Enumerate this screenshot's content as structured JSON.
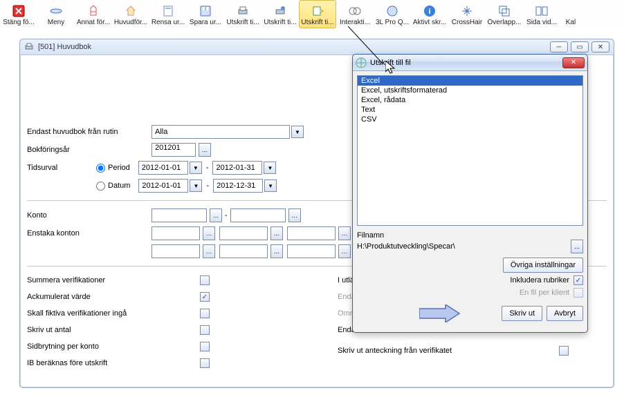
{
  "toolbar": {
    "items": [
      {
        "label": "Stäng fö..."
      },
      {
        "label": "Meny"
      },
      {
        "label": "Annat för..."
      },
      {
        "label": "Huvudför..."
      },
      {
        "label": "Rensa ur..."
      },
      {
        "label": "Spara ur..."
      },
      {
        "label": "Utskrift ti..."
      },
      {
        "label": "Utskrift ti..."
      },
      {
        "label": "Utskrift ti..."
      },
      {
        "label": "Interakti..."
      },
      {
        "label": "3L Pro Q..."
      },
      {
        "label": "Aktivt skr..."
      },
      {
        "label": "CrossHair"
      },
      {
        "label": "Överlapp..."
      },
      {
        "label": "Sida vid..."
      },
      {
        "label": "Kal"
      }
    ]
  },
  "window": {
    "title": "[501]  Huvudbok"
  },
  "form": {
    "rutin_label": "Endast huvudbok från rutin",
    "rutin_value": "Alla",
    "bokforingsar_label": "Bokföringsår",
    "bokforingsar_value": "201201",
    "tidsurval_label": "Tidsurval",
    "period_label": "Period",
    "datum_label": "Datum",
    "period_from": "2012-01-01",
    "period_to": "2012-01-31",
    "datum_from": "2012-01-01",
    "datum_to": "2012-12-31",
    "dash": "-",
    "konto_label": "Konto",
    "enstaka_label": "Enstaka konton",
    "opts_left": [
      {
        "label": "Summera verifikationer",
        "checked": false
      },
      {
        "label": "Ackumulerat värde",
        "checked": true
      },
      {
        "label": "Skall fiktiva verifikationer ingå",
        "checked": false
      },
      {
        "label": "Skriv ut antal",
        "checked": false
      },
      {
        "label": "Sidbrytning per konto",
        "checked": false
      },
      {
        "label": "IB beräknas före utskrift",
        "checked": false
      }
    ],
    "opts_right": [
      {
        "label": "I utländsk valuta",
        "muted": false
      },
      {
        "label": "Endast valuta",
        "muted": true
      },
      {
        "label": "Omräkningsdatum",
        "muted": true
      },
      {
        "label": "Endast minireskontra",
        "muted": false
      }
    ],
    "bottom_label": "Skriv ut anteckning från verifikatet"
  },
  "dialog": {
    "title": "Utskrift till fil",
    "list": [
      "Excel",
      "Excel, utskriftsformaterad",
      "Excel, rådata",
      "Text",
      "CSV"
    ],
    "filnamn_label": "Filnamn",
    "path": "H:\\Produktutveckling\\Specar\\",
    "ovriga": "Övriga inställningar",
    "inkludera": "Inkludera rubriker",
    "enfil": "En fil per klient",
    "skrivut": "Skriv ut",
    "avbryt": "Avbryt",
    "browse": "..."
  }
}
